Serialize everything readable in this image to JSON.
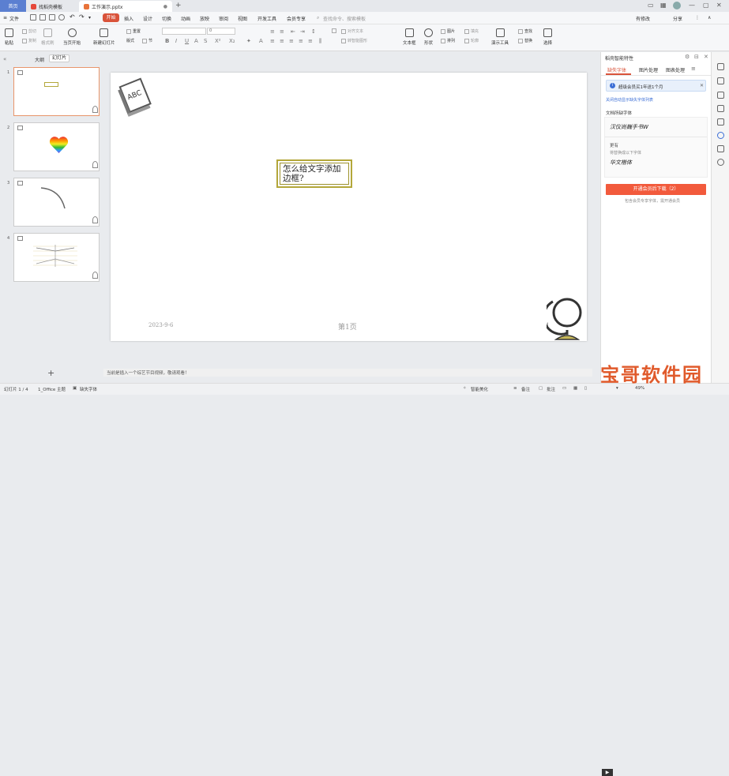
{
  "titlebar": {
    "home_tab": "首页",
    "docer_tab": "找稻壳模板",
    "doc_tab": "工作演示.pptx",
    "new_tab": "+"
  },
  "menubar": {
    "file_label": "文件",
    "items": [
      "开始",
      "插入",
      "设计",
      "切换",
      "动画",
      "放映",
      "审阅",
      "视图",
      "开发工具",
      "会员专享"
    ],
    "search_placeholder": "查找命令、搜索模板",
    "right": [
      "有修改",
      "分享"
    ]
  },
  "ribbon": {
    "paste": "粘贴",
    "cut": "剪切",
    "copy": "复制",
    "format_painter": "格式刷",
    "from_current": "当页开始",
    "new_slide": "新建幻灯片",
    "layout": "版式",
    "section": "节",
    "reset": "重置",
    "font_size_placeholder": "0",
    "text_box": "文本框",
    "shape": "形状",
    "arrange": "排列",
    "image": "图片",
    "fill": "填充",
    "outline": "轮廓",
    "presentation_tools": "演示工具",
    "find": "查找",
    "replace": "替换",
    "select": "选择",
    "align_text": "对齐文本",
    "convert_smartart": "转智能图形"
  },
  "leftpanel": {
    "tab_outline": "大纲",
    "tab_slides": "幻灯片",
    "slide_numbers": [
      "1",
      "2",
      "3",
      "4"
    ],
    "add_button": "+"
  },
  "slide": {
    "textbox_text": "怎么给文字添加边框?",
    "date": "2023-9-6",
    "page_label": "第1页",
    "page_number": "1",
    "book_label": "ABC"
  },
  "notice_bar": "当前是插入一个综艺节目视频，敬请观看！",
  "rightpane": {
    "title": "稻壳智能特性",
    "tabs": [
      "缺失字体",
      "图片处理",
      "图表处理"
    ],
    "alert": "超级会员买1年送1个月",
    "hide_missing": "关闭自动显示缺失字体列表",
    "section_label": "文档所缺字体",
    "font_sample_1": "汉仪尚巍手书W",
    "more_label": "更有",
    "replace_hint": "将替换成以下字体",
    "font_sample_2": "华文楷体",
    "download_button": "开通会员后下载（2）",
    "download_sub": "包含会员专享字体，需开通会员"
  },
  "statusbar": {
    "slide_info": "幻灯片 1 / 4",
    "theme": "1_Office 主题",
    "missing_font": "缺失字体",
    "smart_beautify": "智能美化",
    "notes": "备注",
    "comments": "批注",
    "zoom": "49%"
  },
  "watermark": "宝哥软件园",
  "colors": {
    "accent": "#d9533a",
    "home_tab": "#5b7fd1",
    "textbox_border": "#b3a73a",
    "download_button": "#f25a3c"
  }
}
